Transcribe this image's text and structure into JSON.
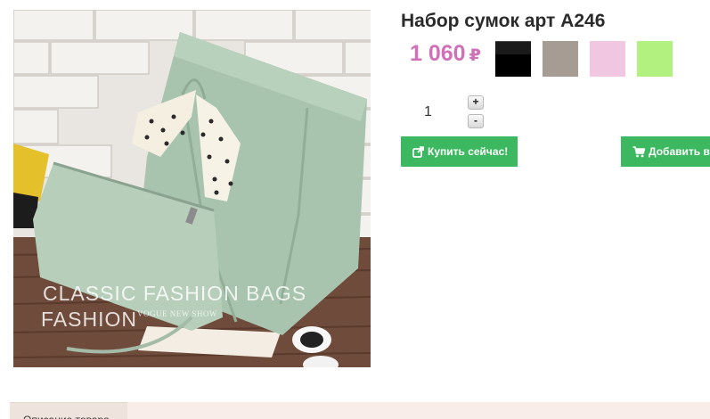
{
  "product": {
    "title": "Набор сумок арт А246",
    "price": "1 060",
    "currency": "₽",
    "image": {
      "watermark_line1": "CLASSIC  FASHION BAGS",
      "watermark_line2": "FASHION",
      "watermark_small": "VOGUE NEW SHOW"
    }
  },
  "colors": [
    {
      "name": "black",
      "hex": "#000000"
    },
    {
      "name": "gray",
      "hex": "#a69c93"
    },
    {
      "name": "pink",
      "hex": "#f1c6e1"
    },
    {
      "name": "light-green",
      "hex": "#b2f07f"
    }
  ],
  "quantity": {
    "value": "1",
    "increment_label": "+",
    "decrement_label": "-"
  },
  "buttons": {
    "buy_now": "Купить сейчас!",
    "buy_now_icon": "share-square-icon",
    "add_to_cart": "Добавить в",
    "add_to_cart_icon": "shopping-cart-icon"
  },
  "tabs": [
    {
      "label": "Описание товара"
    }
  ],
  "theme": {
    "accent_green": "#3cb960",
    "price_color": "#d070b8"
  }
}
